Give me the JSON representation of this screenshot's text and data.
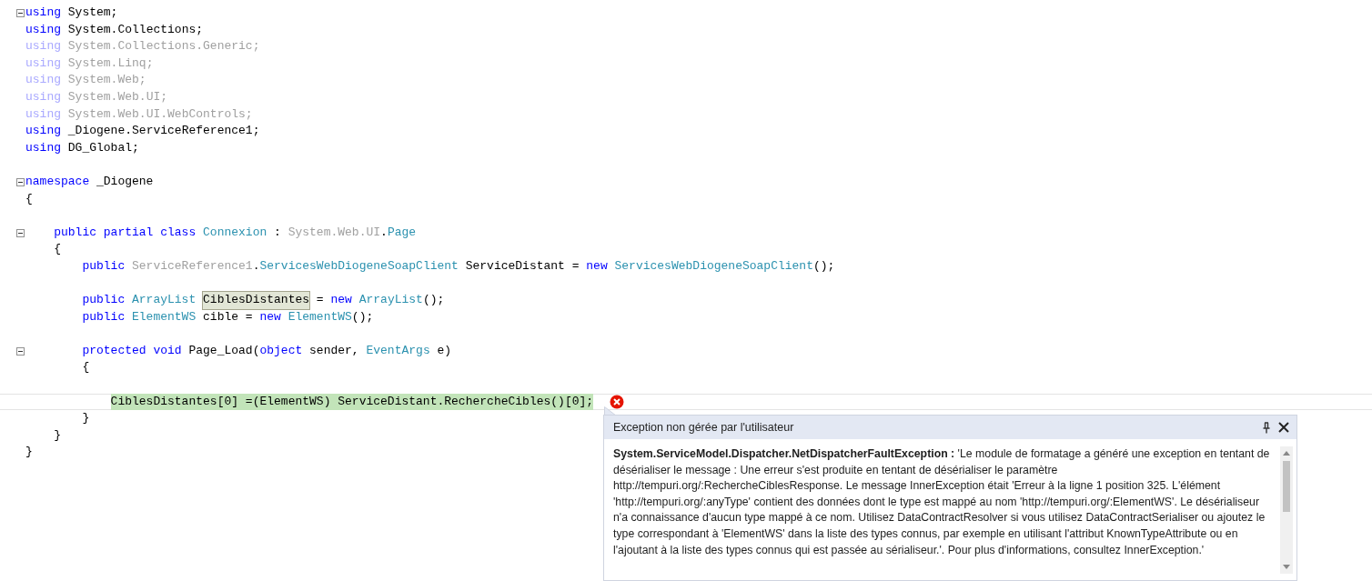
{
  "code_lines": [
    {
      "fold": true,
      "current": false,
      "error": false,
      "segments": [
        {
          "kind": "keyword",
          "text": "using"
        },
        {
          "kind": "plain",
          "text": "System;",
          "space_before": true
        }
      ]
    },
    {
      "fold": false,
      "current": false,
      "error": false,
      "segments": [
        {
          "kind": "keyword",
          "text": "using"
        },
        {
          "kind": "plain",
          "text": "System.Collections;",
          "space_before": true
        }
      ]
    },
    {
      "fold": false,
      "current": false,
      "error": false,
      "segments": [
        {
          "kind": "faded-keyword",
          "text": "using"
        },
        {
          "kind": "faded",
          "text": "System.Collections.Generic;",
          "space_before": true
        }
      ]
    },
    {
      "fold": false,
      "current": false,
      "error": false,
      "segments": [
        {
          "kind": "faded-keyword",
          "text": "using"
        },
        {
          "kind": "faded",
          "text": "System.Linq;",
          "space_before": true
        }
      ]
    },
    {
      "fold": false,
      "current": false,
      "error": false,
      "segments": [
        {
          "kind": "faded-keyword",
          "text": "using"
        },
        {
          "kind": "faded",
          "text": "System.Web;",
          "space_before": true
        }
      ]
    },
    {
      "fold": false,
      "current": false,
      "error": false,
      "segments": [
        {
          "kind": "faded-keyword",
          "text": "using"
        },
        {
          "kind": "faded",
          "text": "System.Web.UI;",
          "space_before": true
        }
      ]
    },
    {
      "fold": false,
      "current": false,
      "error": false,
      "segments": [
        {
          "kind": "faded-keyword",
          "text": "using"
        },
        {
          "kind": "faded",
          "text": "System.Web.UI.WebControls;",
          "space_before": true
        }
      ]
    },
    {
      "fold": false,
      "current": false,
      "error": false,
      "segments": [
        {
          "kind": "keyword",
          "text": "using"
        },
        {
          "kind": "plain",
          "text": "_Diogene.ServiceReference1;",
          "space_before": true
        }
      ]
    },
    {
      "fold": false,
      "current": false,
      "error": false,
      "segments": [
        {
          "kind": "keyword",
          "text": "using"
        },
        {
          "kind": "plain",
          "text": "DG_Global;",
          "space_before": true
        }
      ]
    },
    {
      "fold": false,
      "current": false,
      "error": false
    },
    {
      "fold": true,
      "current": false,
      "error": false,
      "segments": [
        {
          "kind": "keyword",
          "text": "namespace"
        },
        {
          "kind": "plain",
          "text": "_Diogene",
          "space_before": true
        }
      ]
    },
    {
      "fold": false,
      "current": false,
      "error": false,
      "segments": [
        {
          "kind": "plain",
          "text": "{"
        }
      ],
      "children": [
        {
          "fold": false,
          "current": false,
          "error": false
        },
        {
          "fold": true,
          "current": false,
          "error": false,
          "segments": [
            {
              "kind": "keyword",
              "text": "public"
            },
            {
              "kind": "keyword",
              "text": "partial",
              "space_before": true
            },
            {
              "kind": "keyword",
              "text": "class",
              "space_before": true
            },
            {
              "kind": "type",
              "text": "Connexion",
              "space_before": true
            },
            {
              "kind": "plain",
              "text": ":",
              "space_before": true
            },
            {
              "kind": "faded",
              "text": "System.Web.UI",
              "space_before": true
            },
            {
              "kind": "plain",
              "text": "."
            },
            {
              "kind": "type",
              "text": "Page"
            }
          ]
        },
        {
          "fold": false,
          "current": false,
          "error": false,
          "segments": [
            {
              "kind": "plain",
              "text": "{"
            }
          ],
          "children": [
            {
              "fold": false,
              "current": false,
              "error": false,
              "segments": [
                {
                  "kind": "keyword",
                  "text": "public"
                },
                {
                  "kind": "faded",
                  "text": "ServiceReference1",
                  "space_before": true
                },
                {
                  "kind": "plain",
                  "text": "."
                },
                {
                  "kind": "type",
                  "text": "ServicesWebDiogeneSoapClient"
                },
                {
                  "kind": "plain",
                  "text": "ServiceDistant =",
                  "space_before": true
                },
                {
                  "kind": "keyword",
                  "text": "new",
                  "space_before": true
                },
                {
                  "kind": "type",
                  "text": "ServicesWebDiogeneSoapClient",
                  "space_before": true
                },
                {
                  "kind": "plain",
                  "text": "();"
                }
              ]
            },
            {
              "fold": false,
              "current": false,
              "error": false
            },
            {
              "fold": false,
              "current": false,
              "error": false,
              "segments": [
                {
                  "kind": "keyword",
                  "text": "public"
                },
                {
                  "kind": "type",
                  "text": "ArrayList",
                  "space_before": true
                },
                {
                  "kind": "reference",
                  "text": "CiblesDistantes",
                  "space_before": true
                },
                {
                  "kind": "plain",
                  "text": "=",
                  "space_before": true
                },
                {
                  "kind": "keyword",
                  "text": "new",
                  "space_before": true
                },
                {
                  "kind": "type",
                  "text": "ArrayList",
                  "space_before": true
                },
                {
                  "kind": "plain",
                  "text": "();"
                }
              ]
            },
            {
              "fold": false,
              "current": false,
              "error": false,
              "segments": [
                {
                  "kind": "keyword",
                  "text": "public"
                },
                {
                  "kind": "type",
                  "text": "ElementWS",
                  "space_before": true
                },
                {
                  "kind": "plain",
                  "text": "cible =",
                  "space_before": true
                },
                {
                  "kind": "keyword",
                  "text": "new",
                  "space_before": true
                },
                {
                  "kind": "type",
                  "text": "ElementWS",
                  "space_before": true
                },
                {
                  "kind": "plain",
                  "text": "();"
                }
              ]
            },
            {
              "fold": false,
              "current": false,
              "error": false
            },
            {
              "fold": true,
              "current": false,
              "error": false,
              "segments": [
                {
                  "kind": "keyword",
                  "text": "protected"
                },
                {
                  "kind": "keyword",
                  "text": "void",
                  "space_before": true
                },
                {
                  "kind": "plain",
                  "text": "Page_Load(",
                  "space_before": true
                },
                {
                  "kind": "keyword",
                  "text": "object"
                },
                {
                  "kind": "plain",
                  "text": "sender,",
                  "space_before": true
                },
                {
                  "kind": "type",
                  "text": "EventArgs",
                  "space_before": true
                },
                {
                  "kind": "plain",
                  "text": "e)",
                  "space_before": true
                }
              ]
            },
            {
              "fold": false,
              "current": false,
              "error": false,
              "segments": [
                {
                  "kind": "plain",
                  "text": "{"
                }
              ],
              "children": [
                {
                  "fold": false,
                  "current": false,
                  "error": false
                },
                {
                  "fold": false,
                  "current": true,
                  "error": true,
                  "segments": [
                    {
                      "kind": "statement",
                      "text": "CiblesDistantes[0] =(ElementWS) ServiceDistant.RechercheCibles()[0];"
                    }
                  ]
                }
              ]
            },
            {
              "fold": false,
              "current": false,
              "error": false,
              "segments": [
                {
                  "kind": "plain",
                  "text": "}"
                }
              ]
            }
          ]
        },
        {
          "fold": false,
          "current": false,
          "error": false,
          "segments": [
            {
              "kind": "plain",
              "text": "}"
            }
          ]
        }
      ]
    },
    {
      "fold": false,
      "current": false,
      "error": false,
      "segments": [
        {
          "kind": "plain",
          "text": "}"
        }
      ]
    }
  ],
  "exception_popup": {
    "title": "Exception non gérée par l'utilisateur",
    "message": "**System.ServiceModel.Dispatcher.NetDispatcherFaultException :** 'Le module de formatage a généré une exception en tentant de désérialiser le message : Une erreur s'est produite en tentant de désérialiser le paramètre http://tempuri.org/:RechercheCiblesResponse. Le message InnerException était 'Erreur à la ligne 1 position 325. L'élément 'http://tempuri.org/:anyType' contient des données dont le type est mappé au nom 'http://tempuri.org/:ElementWS'. Le désérialiseur n'a connaissance d'aucun type mappé à ce nom. Utilisez DataContractResolver si vous utilisez DataContractSerialiser ou ajoutez le type correspondant à 'ElementWS' dans la liste des types connus, par exemple en utilisant l'attribut KnownTypeAttribute ou en l'ajoutant à la liste des types connus qui est passée au sérialiseur.'. Pour plus d'informations, consultez InnerException.'"
  }
}
